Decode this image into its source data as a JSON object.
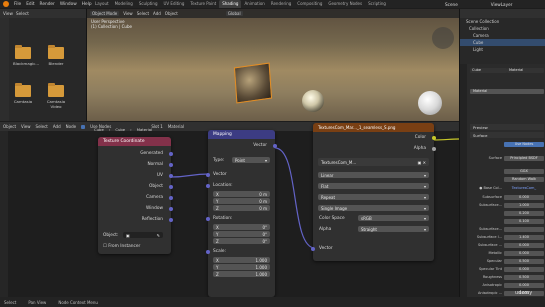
{
  "topbar": {
    "menus": [
      "File",
      "Edit",
      "Render",
      "Window",
      "Help"
    ],
    "tabs": [
      "Layout",
      "Modeling",
      "Sculpting",
      "UV Editing",
      "Texture Paint",
      "Shading",
      "Animation",
      "Rendering",
      "Compositing",
      "Geometry Nodes",
      "Scripting"
    ],
    "active_tab": "Shading",
    "scene": "Scene",
    "view_layer": "ViewLayer"
  },
  "filebrowser": {
    "header": [
      "View",
      "Select"
    ],
    "folders": [
      "Blackmagic...",
      "Blender",
      "Camtasia",
      "Camtasia Video"
    ]
  },
  "viewport": {
    "mode": "Object Mode",
    "menus": [
      "View",
      "Select",
      "Add",
      "Object"
    ],
    "orientation": "Global",
    "info_line1": "User Perspective",
    "info_line2": "(1) Collection | Cube"
  },
  "outliner": {
    "title": "Scene Collection",
    "rows": [
      "Collection",
      "Camera",
      "Cube",
      "Light"
    ]
  },
  "properties": {
    "object": "Cube",
    "material_slot": "Material",
    "material_name": "Material",
    "sections": [
      "Preview",
      "Surface"
    ],
    "use_nodes": "Use Nodes",
    "surface_value": "Principled BSDF",
    "distribution": "GGX",
    "subsurface_method": "Random Walk",
    "base_color_link": "TexturesCom_",
    "rows": [
      {
        "label": "Subsurface",
        "value": "0.000"
      },
      {
        "label": "Subsurface...",
        "value": "1.000"
      },
      {
        "label": "",
        "value": "0.200"
      },
      {
        "label": "",
        "value": "0.100"
      },
      {
        "label": "Subsurface...",
        "value": ""
      },
      {
        "label": "Subsurface I...",
        "value": "1.400"
      },
      {
        "label": "Subsurface ...",
        "value": "0.000"
      },
      {
        "label": "Metallic",
        "value": "0.000"
      },
      {
        "label": "Specular",
        "value": "0.500"
      },
      {
        "label": "Specular Tint",
        "value": "0.000"
      },
      {
        "label": "Roughness",
        "value": "0.500"
      },
      {
        "label": "Anisotropic",
        "value": "0.000"
      },
      {
        "label": "Anisotropic ...",
        "value": "0.000"
      }
    ]
  },
  "node_editor": {
    "mode": "Object",
    "menus": [
      "View",
      "Select",
      "Add",
      "Node"
    ],
    "use_nodes": "Use Nodes",
    "slot": "Slot 1",
    "material": "Material",
    "breadcrumb": [
      "Cube",
      "Cube",
      "Material"
    ],
    "texcoord": {
      "title": "Texture Coordinate",
      "outputs": [
        "Generated",
        "Normal",
        "UV",
        "Object",
        "Camera",
        "Window",
        "Reflection"
      ],
      "object_label": "Object:",
      "from_instancer": "From Instancer"
    },
    "mapping": {
      "title": "Mapping",
      "output": "Vector",
      "type_label": "Type:",
      "type_value": "Point",
      "vector_in": "Vector",
      "location_label": "Location:",
      "location": [
        {
          "axis": "X",
          "value": "0 m"
        },
        {
          "axis": "Y",
          "value": "0 m"
        },
        {
          "axis": "Z",
          "value": "0 m"
        }
      ],
      "rotation_label": "Rotation:",
      "rotation": [
        {
          "axis": "X",
          "value": "0°"
        },
        {
          "axis": "Y",
          "value": "0°"
        },
        {
          "axis": "Z",
          "value": "0°"
        }
      ],
      "scale_label": "Scale:",
      "scale": [
        {
          "axis": "X",
          "value": "1.000"
        },
        {
          "axis": "Y",
          "value": "1.000"
        },
        {
          "axis": "Z",
          "value": "1.000"
        }
      ]
    },
    "image_tex": {
      "title": "TexturesCom_Mar..._1_seamless_S.png",
      "out_color": "Color",
      "out_alpha": "Alpha",
      "image_name": "TexturesCom_M...",
      "interpolation": "Linear",
      "projection": "Flat",
      "extension": "Repeat",
      "source": "Single Image",
      "colorspace_label": "Color Space",
      "colorspace": "sRGB",
      "alpha_label": "Alpha",
      "alpha": "Straight",
      "vector_in": "Vector"
    }
  },
  "statusbar": [
    "Select",
    "Pan View",
    "Node Context Menu"
  ],
  "watermark": "udemy",
  "colors": {
    "accent": "#e87d0d",
    "texcoord_header": "#83314a",
    "mapping_header": "#3c3c83",
    "image_header": "#793f13",
    "socket_vector": "#6363c7",
    "socket_color": "#c7c729",
    "socket_gray": "#a1a1a1"
  }
}
